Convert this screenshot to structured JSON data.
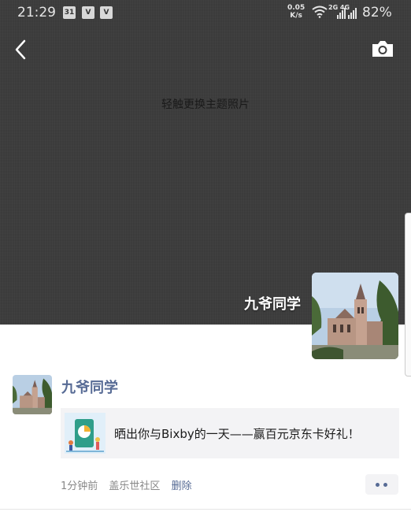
{
  "status_bar": {
    "time": "21:29",
    "calendar_badge": "31",
    "net_speed_value": "0.05",
    "net_speed_unit": "K/s",
    "net_labels": "2G 4G",
    "battery": "82%"
  },
  "cover": {
    "hint": "轻触更换主题照片",
    "user_name": "九爷同学"
  },
  "post": {
    "user_name": "九爷同学",
    "share_title": "晒出你与Bixby的一天——赢百元京东卡好礼！",
    "time": "1分钟前",
    "location": "盖乐世社区",
    "delete_label": "删除"
  },
  "colors": {
    "link": "#576b95",
    "cover_bg": "#3e3e3e",
    "card_bg": "#f3f3f5"
  },
  "icons": {
    "back": "back-arrow-icon",
    "camera": "camera-icon",
    "more": "more-dots-icon"
  }
}
